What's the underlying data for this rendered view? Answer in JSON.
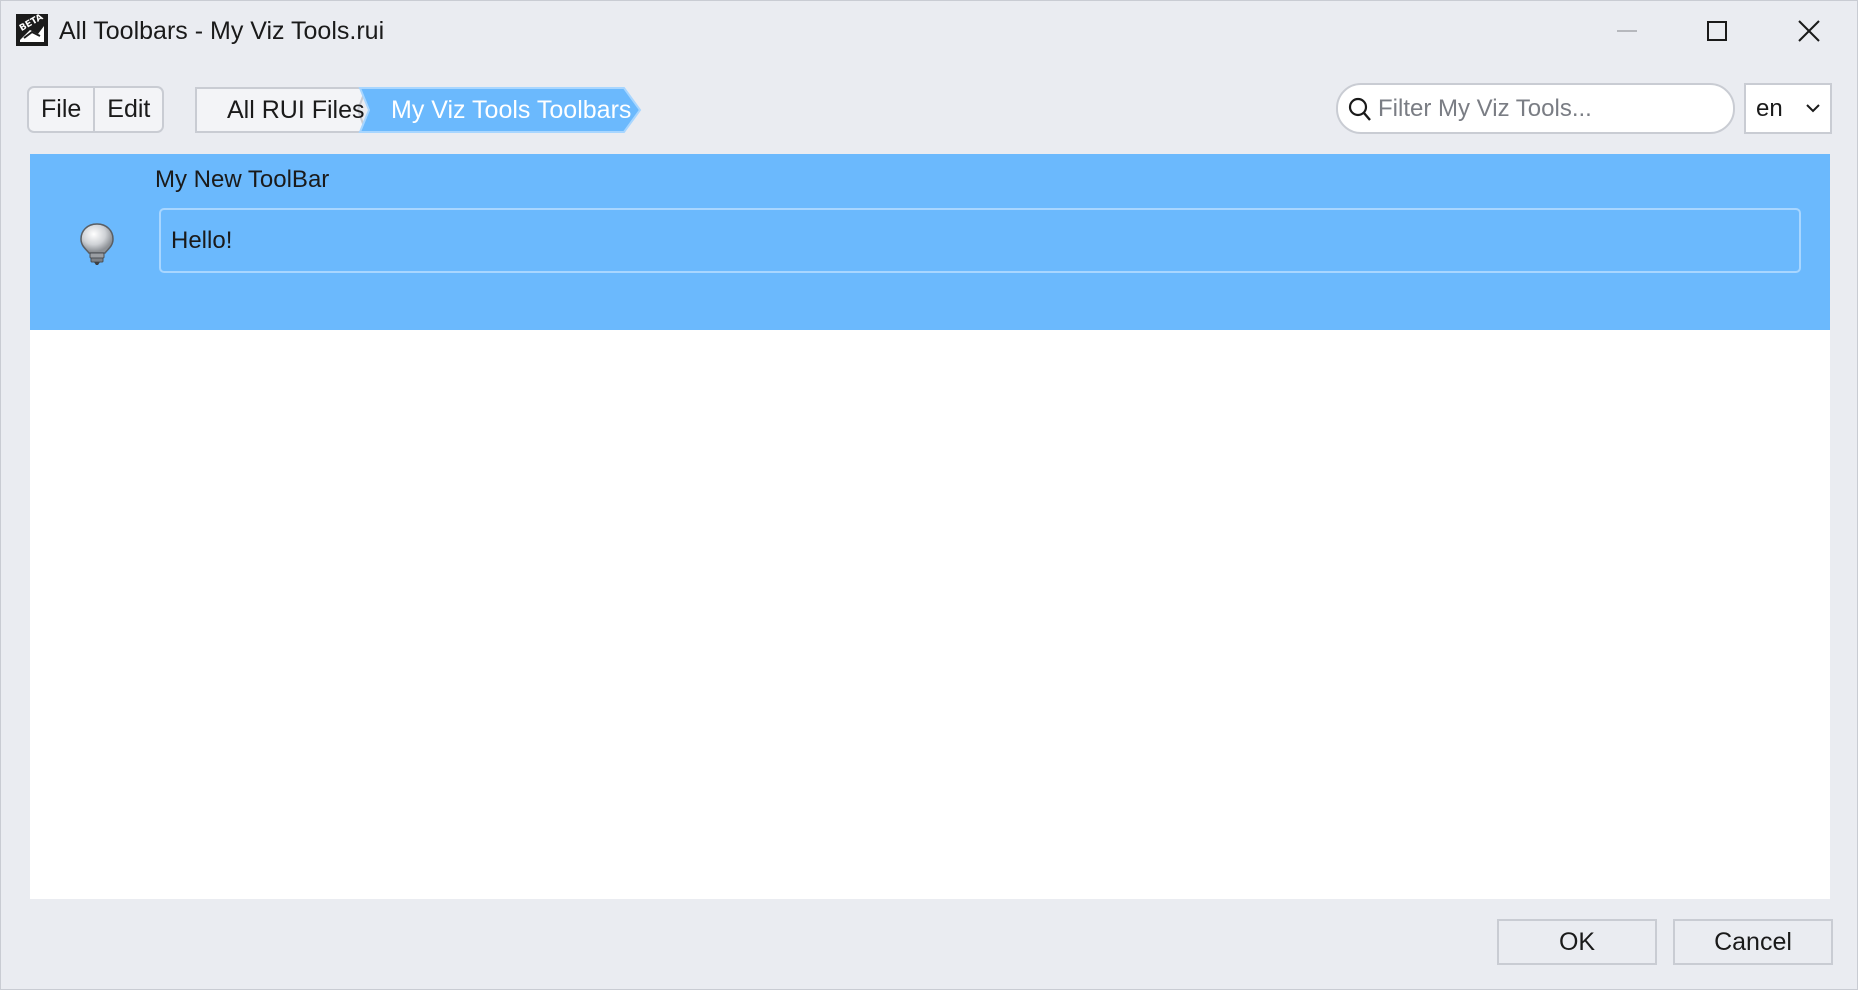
{
  "window": {
    "title": "All Toolbars - My Viz Tools.rui",
    "app_icon_badge": "BETA"
  },
  "menu": {
    "file_label": "File",
    "edit_label": "Edit"
  },
  "breadcrumb": {
    "items": [
      {
        "label": "All RUI Files",
        "active": false
      },
      {
        "label": "My Viz Tools Toolbars",
        "active": true
      }
    ]
  },
  "search": {
    "value": "",
    "placeholder": "Filter My Viz Tools..."
  },
  "language": {
    "selected": "en"
  },
  "toolbars": [
    {
      "name": "My New ToolBar",
      "value": "Hello!",
      "icon": "lightbulb-icon",
      "selected": true
    }
  ],
  "footer": {
    "ok_label": "OK",
    "cancel_label": "Cancel"
  },
  "colors": {
    "window_bg": "#eaecf1",
    "selection": "#6bb9fd",
    "border": "#c9ccd3"
  }
}
